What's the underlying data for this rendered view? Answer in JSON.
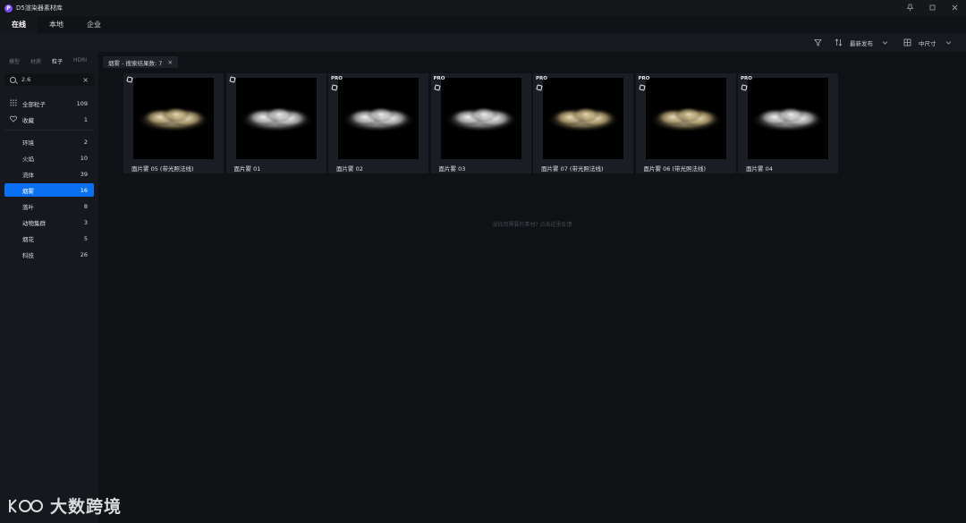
{
  "window": {
    "title": "D5渲染器素材库",
    "logo_letter": "P"
  },
  "top_tabs": [
    {
      "label": "在线",
      "active": true
    },
    {
      "label": "本地",
      "active": false
    },
    {
      "label": "企业",
      "active": false
    }
  ],
  "toolbar": {
    "sort_label": "最新发布",
    "size_label": "中尺寸"
  },
  "sidebar": {
    "category_tabs": [
      {
        "label": "模型",
        "active": false
      },
      {
        "label": "材质",
        "active": false
      },
      {
        "label": "粒子",
        "active": true
      },
      {
        "label": "HDRI",
        "active": false
      }
    ],
    "search_value": "2.6",
    "all_label": "全部粒子",
    "all_count": "109",
    "fav_label": "收藏",
    "fav_count": "1",
    "items": [
      {
        "label": "环境",
        "count": "2",
        "active": false
      },
      {
        "label": "火焰",
        "count": "10",
        "active": false
      },
      {
        "label": "流体",
        "count": "39",
        "active": false
      },
      {
        "label": "烟雾",
        "count": "16",
        "active": true
      },
      {
        "label": "落叶",
        "count": "8",
        "active": false
      },
      {
        "label": "动物集群",
        "count": "3",
        "active": false
      },
      {
        "label": "烟花",
        "count": "5",
        "active": false
      },
      {
        "label": "科技",
        "count": "26",
        "active": false
      }
    ]
  },
  "main": {
    "filter_chip": "烟雾 - 搜索结果数: 7",
    "cards": [
      {
        "title": "面片雾 05 (带光照法线)",
        "pro": false,
        "tint": "warm"
      },
      {
        "title": "面片雾 01",
        "pro": false,
        "tint": "white"
      },
      {
        "title": "面片雾 02",
        "pro": true,
        "tint": "white"
      },
      {
        "title": "面片雾 03",
        "pro": true,
        "tint": "white"
      },
      {
        "title": "面片雾 07 (带光照法线)",
        "pro": true,
        "tint": "warm"
      },
      {
        "title": "面片雾 06 (带光照法线)",
        "pro": true,
        "tint": "warm"
      },
      {
        "title": "面片雾 04",
        "pro": true,
        "tint": "white"
      }
    ],
    "pro_label": "PRO",
    "empty_hint": "没找到需要的素材? 点击这里反馈"
  },
  "watermark": {
    "text": "大数跨境"
  },
  "colors": {
    "accent": "#0a6ff0",
    "brand": "#7b4dff",
    "background": "#0f1114"
  }
}
